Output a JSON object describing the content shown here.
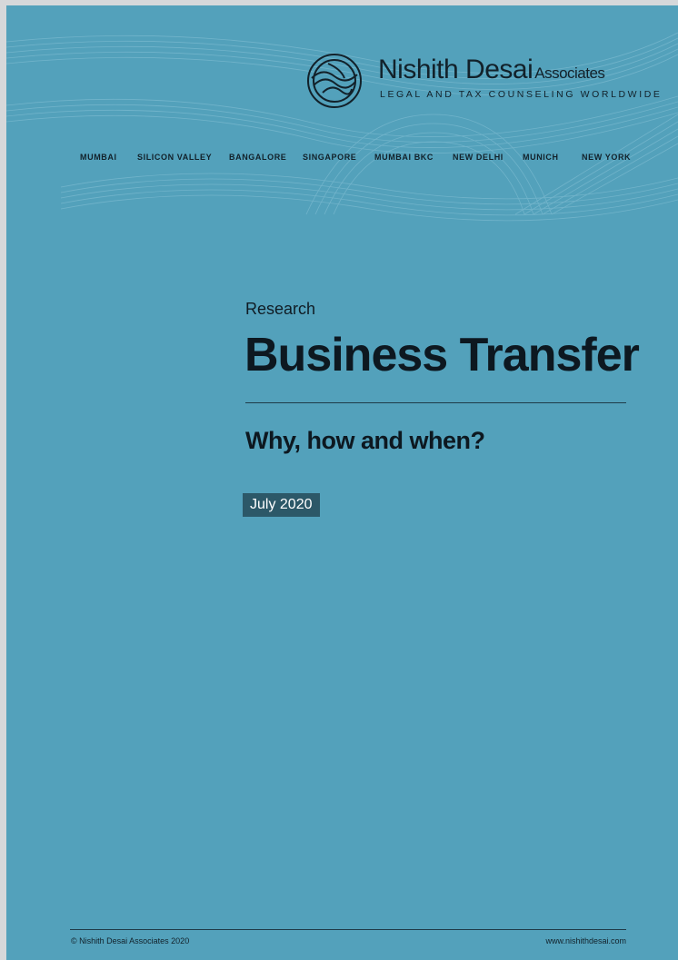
{
  "brand": {
    "name": "Nishith Desai",
    "suffix": "Associates",
    "tagline": "LEGAL AND TAX COUNSELING WORLDWIDE"
  },
  "offices": [
    "MUMBAI",
    "SILICON VALLEY",
    "BANGALORE",
    "SINGAPORE",
    "MUMBAI BKC",
    "NEW DELHI",
    "MUNICH",
    "NEW YORK"
  ],
  "cover": {
    "kicker": "Research",
    "title": "Business Transfer",
    "subtitle": "Why, how and when?",
    "date": "July 2020"
  },
  "footer": {
    "copyright": "© Nishith Desai Associates 2020",
    "website": "www.nishithdesai.com"
  },
  "colors": {
    "page_background": "#53a1bb",
    "date_badge": "#2c5868",
    "text": "#0d1820"
  }
}
